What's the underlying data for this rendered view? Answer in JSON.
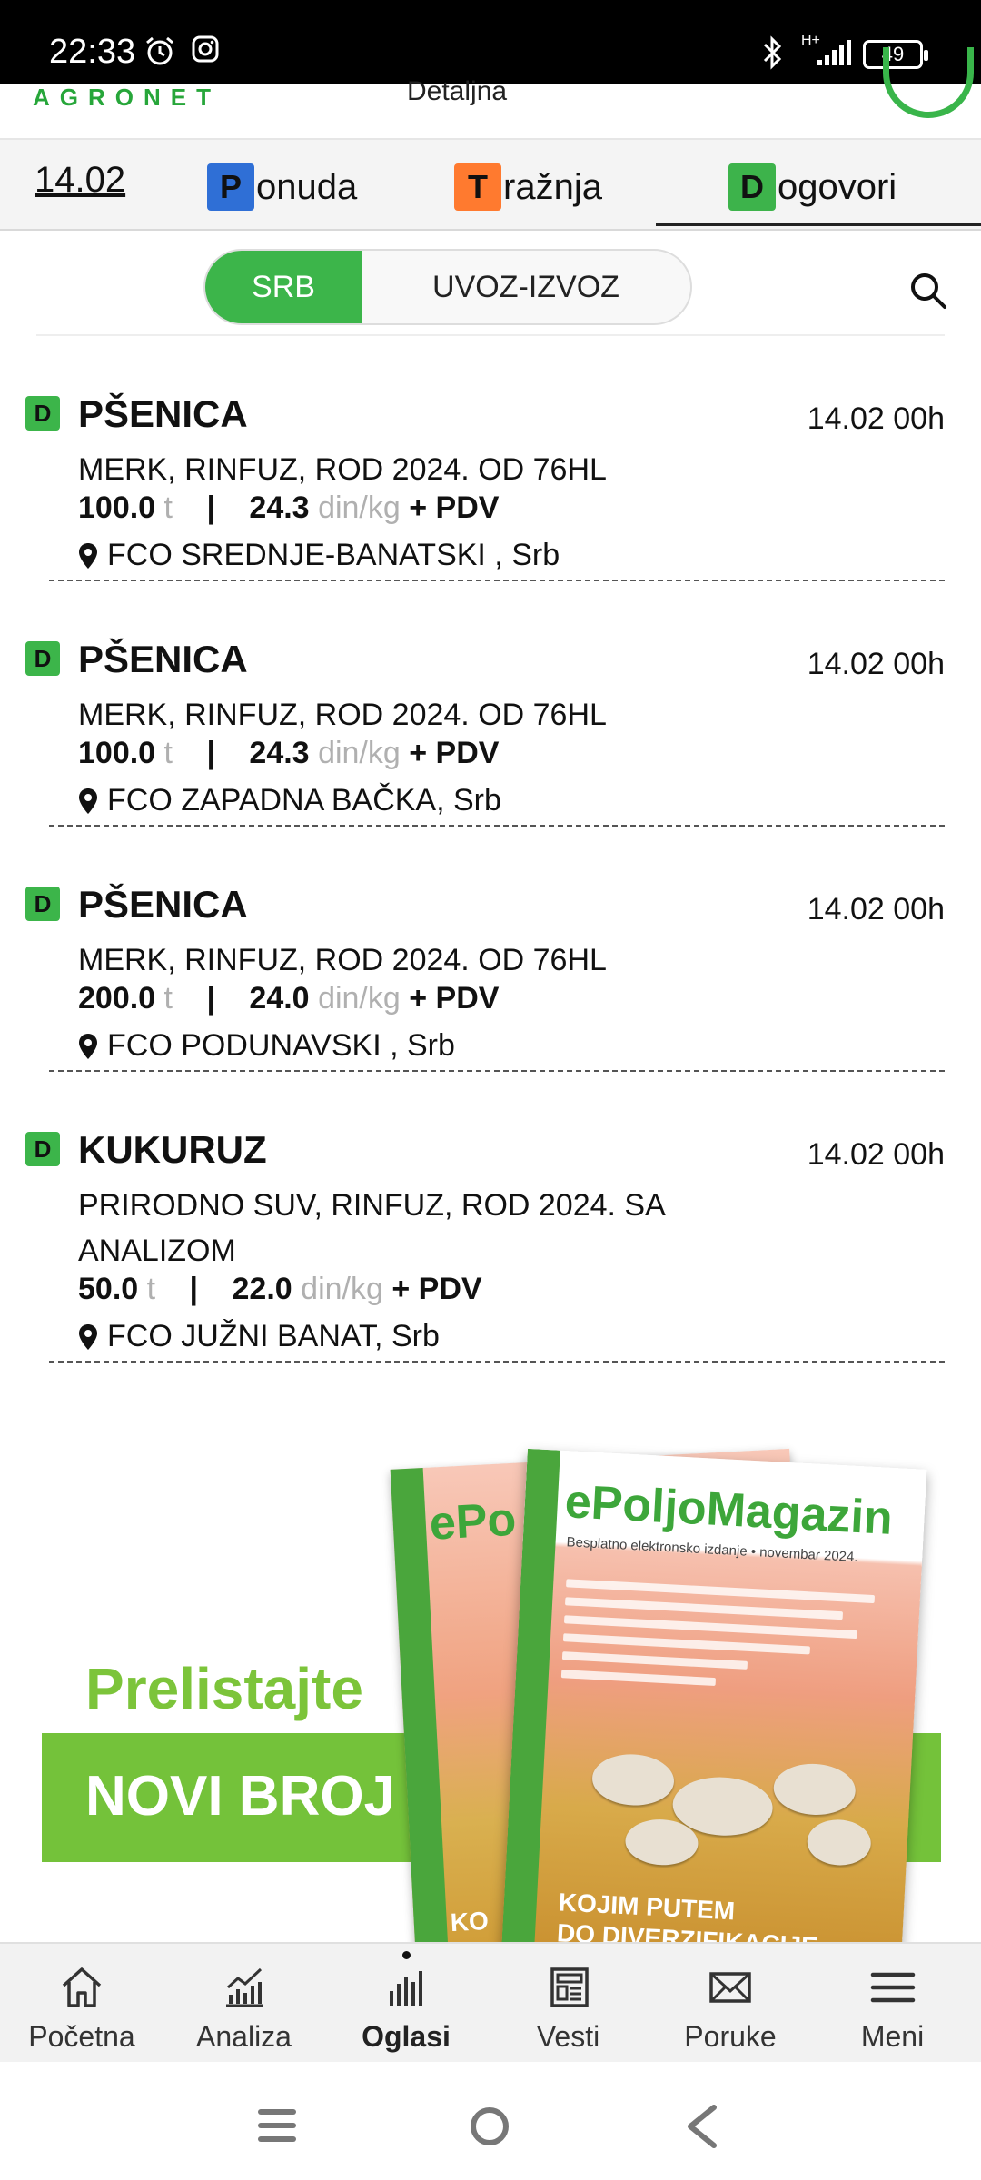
{
  "status_bar": {
    "time": "22:33",
    "network": "H+",
    "battery": "49",
    "icons": [
      "alarm-icon",
      "instagram-icon",
      "bluetooth-icon",
      "signal-icon",
      "battery-icon"
    ]
  },
  "header": {
    "brand": "AGRONET",
    "title": "Detaljna"
  },
  "tabs": {
    "date": "14.02",
    "ponuda": {
      "letter": "P",
      "rest": "onuda"
    },
    "traznja": {
      "letter": "T",
      "rest": "ražnja"
    },
    "dogovori": {
      "letter": "D",
      "rest": "ogovori"
    },
    "active": "dogovori"
  },
  "filter": {
    "srb": "SRB",
    "uvoz_izvoz": "UVOZ-IZVOZ",
    "selected": "SRB"
  },
  "listings": [
    {
      "badge": "D",
      "product": "PŠENICA",
      "timestamp": "14.02 00h",
      "description": "MERK, RINFUZ, ROD 2024. OD 76HL",
      "quantity": "100.0",
      "quantity_unit": "t",
      "separator": "|",
      "price": "24.3",
      "price_unit": "din/kg",
      "tax": "+ PDV",
      "location": "FCO SREDNJE-BANATSKI , Srb"
    },
    {
      "badge": "D",
      "product": "PŠENICA",
      "timestamp": "14.02 00h",
      "description": "MERK, RINFUZ, ROD 2024. OD 76HL",
      "quantity": "100.0",
      "quantity_unit": "t",
      "separator": "|",
      "price": "24.3",
      "price_unit": "din/kg",
      "tax": "+ PDV",
      "location": "FCO ZAPADNA BAČKA, Srb"
    },
    {
      "badge": "D",
      "product": "PŠENICA",
      "timestamp": "14.02 00h",
      "description": "MERK, RINFUZ, ROD 2024. OD 76HL",
      "quantity": "200.0",
      "quantity_unit": "t",
      "separator": "|",
      "price": "24.0",
      "price_unit": "din/kg",
      "tax": "+ PDV",
      "location": "FCO PODUNAVSKI , Srb"
    },
    {
      "badge": "D",
      "product": "KUKURUZ",
      "timestamp": "14.02 00h",
      "description": "PRIRODNO SUV, RINFUZ, ROD 2024. SA ANALIZOM",
      "quantity": "50.0",
      "quantity_unit": "t",
      "separator": "|",
      "price": "22.0",
      "price_unit": "din/kg",
      "tax": "+ PDV",
      "location": "FCO JUŽNI BANAT, Srb"
    }
  ],
  "banner": {
    "line1": "Prelistajte",
    "line2": "NOVI BROJ",
    "magazine_title": "ePoljoMagazin",
    "magazine_back_title": "ePo",
    "magazine_subtitle": "Besplatno elektronsko izdanje • novembar 2024.",
    "magazine_bottom": "KOJIM PUTEM\nDO DIVERZIFIKACIJE",
    "magazine_back_bottom": "KO"
  },
  "bottom_nav": [
    {
      "label": "Početna",
      "icon": "home-icon",
      "active": false
    },
    {
      "label": "Analiza",
      "icon": "analytics-icon",
      "active": false
    },
    {
      "label": "Oglasi",
      "icon": "bar-chart-icon",
      "active": true
    },
    {
      "label": "Vesti",
      "icon": "newspaper-icon",
      "active": false
    },
    {
      "label": "Poruke",
      "icon": "envelope-icon",
      "active": false
    },
    {
      "label": "Meni",
      "icon": "menu-icon",
      "active": false
    }
  ],
  "colors": {
    "brand_green": "#3cb54a",
    "ponuda_blue": "#2f6fd6",
    "traznja_orange": "#ff7a2f",
    "muted_unit": "#b0b0b0"
  }
}
